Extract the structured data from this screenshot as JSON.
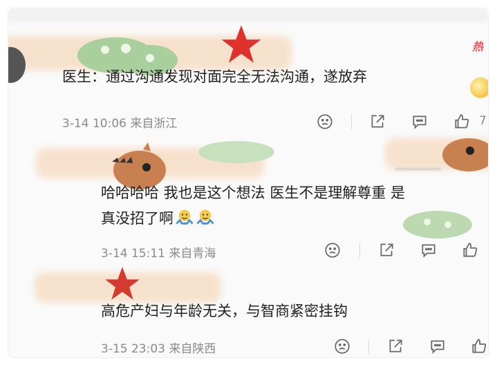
{
  "badges": {
    "hot": "热"
  },
  "comments": [
    {
      "text": "医生：通过沟通发现对面完全无法沟通，遂放弃",
      "meta": "3-14 10:06 来自浙江",
      "like_count": "7"
    },
    {
      "text_line1": "哈哈哈哈 我也是这个想法  医生不是理解尊重  是",
      "text_line2": "真没招了啊",
      "meta": "3-14 15:11 来自青海"
    },
    {
      "text": "高危产妇与年龄无关，与智商紧密挂钩",
      "meta": "3-15 23:03 来自陕西"
    }
  ],
  "icons": {
    "sad": "sad-face-icon",
    "share": "share-icon",
    "comment": "comment-icon",
    "like": "thumbs-up-icon",
    "emoji": "shrug-emoji-icon"
  },
  "colors": {
    "accent_red": "#ff4e5a",
    "star_red": "#e0322d",
    "text": "#222222",
    "meta": "#8a8a8a"
  }
}
